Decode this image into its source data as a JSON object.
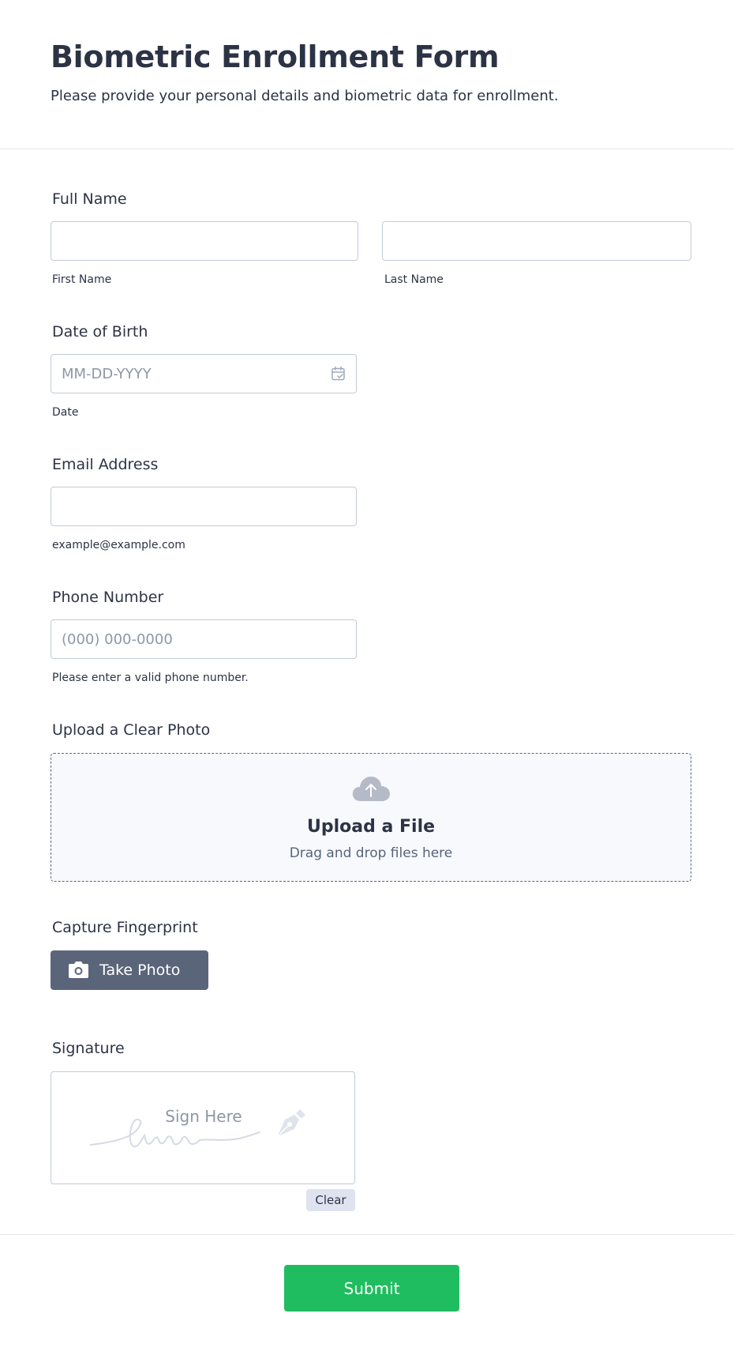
{
  "header": {
    "title": "Biometric Enrollment Form",
    "subtitle": "Please provide your personal details and biometric data for enrollment."
  },
  "full_name": {
    "label": "Full Name",
    "first": {
      "value": "",
      "sublabel": "First Name"
    },
    "last": {
      "value": "",
      "sublabel": "Last Name"
    }
  },
  "dob": {
    "label": "Date of Birth",
    "placeholder": "MM-DD-YYYY",
    "sublabel": "Date",
    "icon": "calendar-icon"
  },
  "email": {
    "label": "Email Address",
    "value": "",
    "sublabel": "example@example.com"
  },
  "phone": {
    "label": "Phone Number",
    "placeholder": "(000) 000-0000",
    "sublabel": "Please enter a valid phone number."
  },
  "photo_upload": {
    "label": "Upload a Clear Photo",
    "title": "Upload a File",
    "subtitle": "Drag and drop files here",
    "icon": "cloud-upload-icon"
  },
  "fingerprint": {
    "label": "Capture Fingerprint",
    "button_label": "Take Photo",
    "icon": "camera-icon"
  },
  "signature": {
    "label": "Signature",
    "prompt": "Sign Here",
    "clear_label": "Clear",
    "icon": "pen-nib-icon"
  },
  "submit": {
    "label": "Submit",
    "color": "#1fbd5f"
  },
  "colors": {
    "text": "#2c3345",
    "muted": "#8d97a8",
    "border": "#c3cad8",
    "button_dark": "#5b6579",
    "clear_bg": "#dfe3f0"
  }
}
